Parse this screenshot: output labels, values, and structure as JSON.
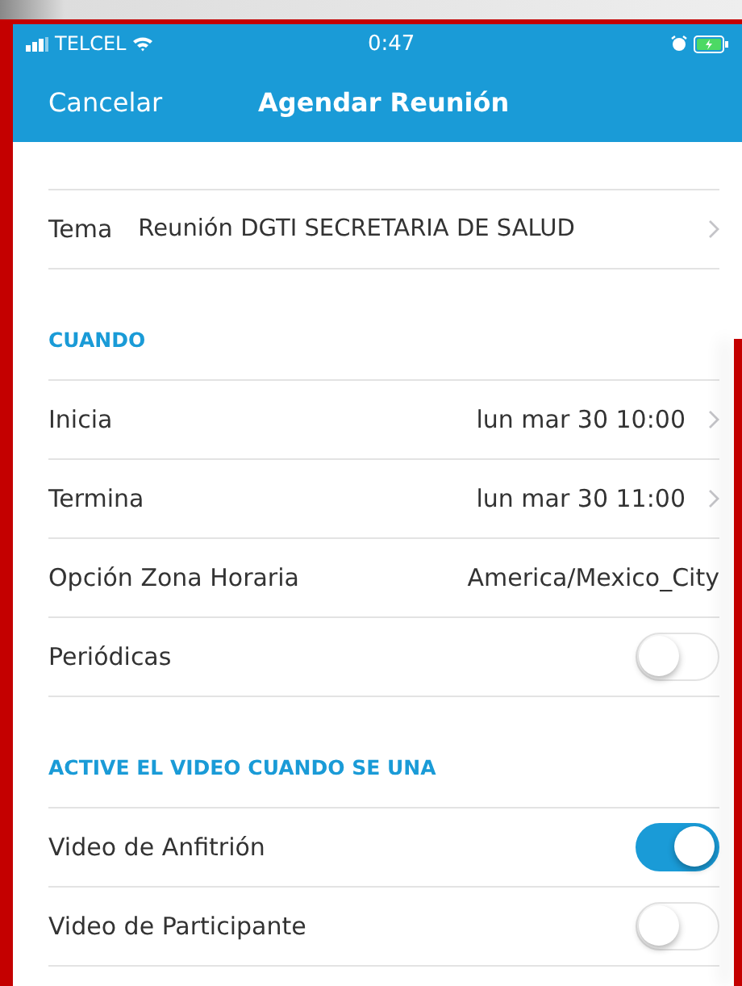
{
  "status_bar": {
    "carrier": "TELCEL",
    "time": "0:47"
  },
  "nav": {
    "cancel": "Cancelar",
    "title": "Agendar Reunión"
  },
  "sections": [
    {
      "rows": [
        {
          "kind": "disclosure",
          "label": "Tema",
          "value": "Reunión DGTI SECRETARIA DE SALUD"
        }
      ]
    },
    {
      "header": "CUANDO",
      "rows": [
        {
          "kind": "disclosure",
          "label": "Inicia",
          "value": "lun mar 30 10:00"
        },
        {
          "kind": "value",
          "label": "Termina",
          "value": "lun mar 30 11:00",
          "chevron": true
        },
        {
          "kind": "value",
          "label": "Opción Zona Horaria",
          "value": "America/Mexico_City",
          "chevron": false
        },
        {
          "kind": "toggle",
          "label": "Periódicas",
          "on": false
        }
      ]
    },
    {
      "header": "ACTIVE EL VIDEO CUANDO SE UNA",
      "rows": [
        {
          "kind": "toggle",
          "label": "Video de Anfitrión",
          "on": true
        },
        {
          "kind": "toggle",
          "label": "Video de Participante",
          "on": false
        }
      ]
    }
  ]
}
